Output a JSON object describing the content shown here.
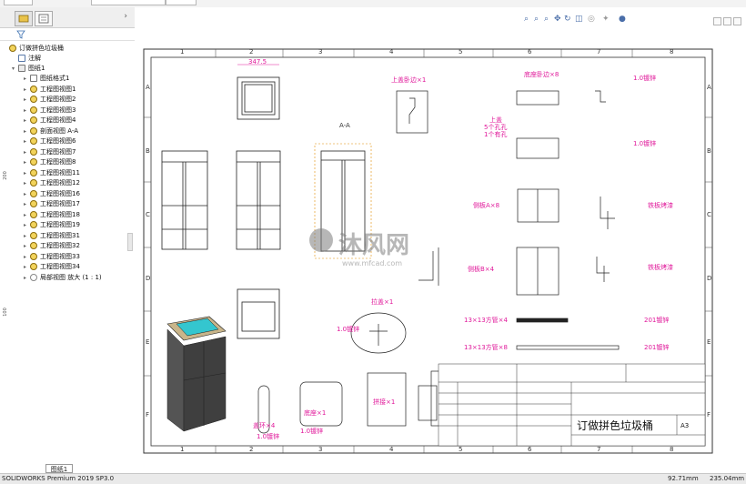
{
  "feature_tree": {
    "root": "订做拼色垃圾桶",
    "annotations": "注解",
    "sheet": "图纸1",
    "items": [
      {
        "label": "图纸格式1",
        "icon": "sheet-format-icon"
      },
      {
        "label": "工程图视图1",
        "icon": "drawing-view-icon"
      },
      {
        "label": "工程图视图2",
        "icon": "drawing-view-icon"
      },
      {
        "label": "工程图视图3",
        "icon": "drawing-view-icon"
      },
      {
        "label": "工程图视图4",
        "icon": "drawing-view-icon"
      },
      {
        "label": "剖面视图 A-A",
        "icon": "section-view-icon"
      },
      {
        "label": "工程图视图6",
        "icon": "drawing-view-icon"
      },
      {
        "label": "工程图视图7",
        "icon": "drawing-view-icon"
      },
      {
        "label": "工程图视图8",
        "icon": "drawing-view-icon"
      },
      {
        "label": "工程图视图11",
        "icon": "drawing-view-icon"
      },
      {
        "label": "工程图视图12",
        "icon": "drawing-view-icon"
      },
      {
        "label": "工程图视图16",
        "icon": "drawing-view-icon"
      },
      {
        "label": "工程图视图17",
        "icon": "drawing-view-icon"
      },
      {
        "label": "工程图视图18",
        "icon": "drawing-view-icon"
      },
      {
        "label": "工程图视图19",
        "icon": "drawing-view-icon"
      },
      {
        "label": "工程图视图31",
        "icon": "drawing-view-icon"
      },
      {
        "label": "工程图视图32",
        "icon": "drawing-view-icon"
      },
      {
        "label": "工程图视图33",
        "icon": "drawing-view-icon"
      },
      {
        "label": "工程图视图34",
        "icon": "drawing-view-icon"
      },
      {
        "label": "局部视图 放大 (1 : 1)",
        "icon": "detail-view-icon"
      }
    ]
  },
  "drawing": {
    "title": "订做拼色垃圾桶",
    "size": "A3",
    "zones_top": [
      "1",
      "2",
      "3",
      "4",
      "5",
      "6",
      "7",
      "8"
    ],
    "zones_side": [
      "A",
      "B",
      "C",
      "D",
      "E",
      "F"
    ],
    "notes": {
      "lid_edge": "上盖卧边×1",
      "bottom_edge": "底座卧边×8",
      "top_lid": "上盖",
      "top_lid2": "5个孔孔",
      "top_lid3": "1个有孔",
      "side_a": "侧板A×8",
      "side_b": "侧板B×4",
      "hanger": "拉盖×1",
      "tube1": "13×13方管×4",
      "tube2": "13×13方管×8",
      "bottom": "底座×1",
      "lid_ring": "盖环×4",
      "frame": "拼接×1",
      "steel1": "1.0镀锌",
      "steel2": "1.0镀锌",
      "steel3": "1.0镀锌",
      "steel4": "1.0镀锌",
      "steel5": "1.0镀锌",
      "iron1": "铁板烤漆",
      "iron2": "铁板烤漆",
      "ss1": "201镀锌",
      "ss2": "201镀锌",
      "dim_top": "347.5",
      "section_label": "A-A"
    }
  },
  "sheet_tab": "图纸1",
  "status": {
    "app": "SOLIDWORKS Premium 2019 SP3.0",
    "x": "92.71mm",
    "y": "235.04mm"
  },
  "ruler": {
    "v1": "200",
    "v2": "100"
  },
  "watermark": {
    "brand": "沐风网",
    "url": "www.mfcad.com"
  },
  "colors": {
    "dim": "#e0189a",
    "line": "#111111",
    "border": "#222222"
  }
}
